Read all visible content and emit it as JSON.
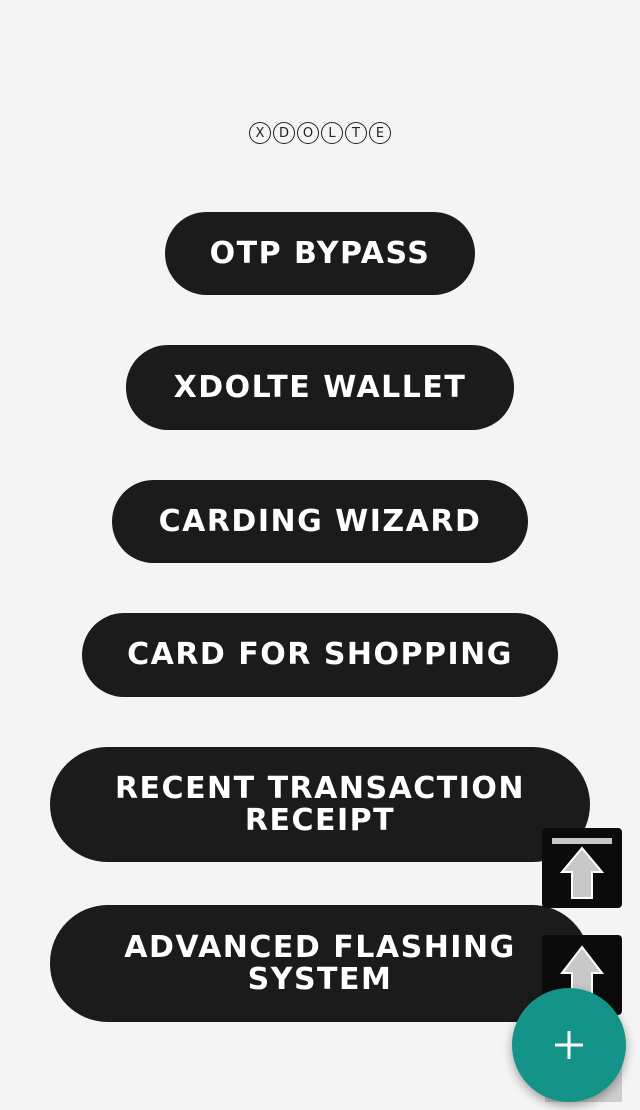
{
  "logo": {
    "letters": [
      "X",
      "D",
      "O",
      "L",
      "T",
      "E"
    ]
  },
  "menu": {
    "otp_bypass": "OTP BYPASS",
    "xdolte_wallet": "XDOLTE WALLET",
    "carding_wizard": "CARDING WIZARD",
    "card_for_shopping": "CARD FOR SHOPPING",
    "recent_transaction_receipt": "RECENT TRANSACTION RECEIPT",
    "advanced_flashing_system": "ADVANCED FLASHING SYSTEM"
  },
  "floating_controls": {
    "scroll_to_top_icon": "arrow-to-top-icon",
    "scroll_up_icon": "arrow-up-icon",
    "fab_icon": "plus-icon"
  },
  "colors": {
    "background": "#f4f4f4",
    "button": "#1b1b1b",
    "button_text": "#ffffff",
    "fab": "#149488"
  }
}
